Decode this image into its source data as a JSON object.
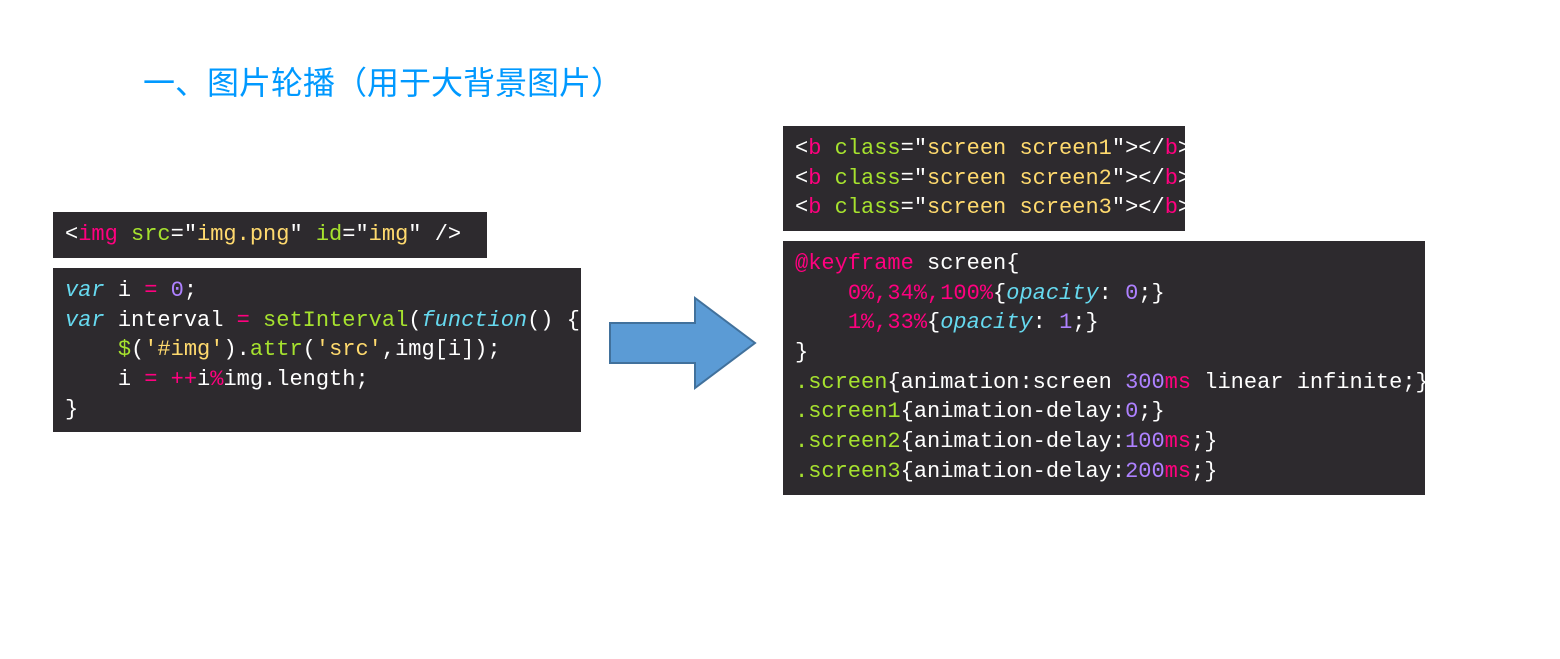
{
  "heading": "一、图片轮播（用于大背景图片）",
  "blk1": {
    "open_brkt": "<",
    "tag": "img",
    "sp1": " ",
    "a1": "src",
    "eq1": "=",
    "q1a": "\"",
    "v1": "img.png",
    "q1b": "\"",
    "sp2": " ",
    "a2": "id",
    "eq2": "=",
    "q2a": "\"",
    "v2": "img",
    "q2b": "\"",
    "sp3": " ",
    "selfclose": "/>"
  },
  "blk2": {
    "l1_var": "var",
    "l1_sp": " ",
    "l1_name": "i",
    "l1_sp2": " ",
    "l1_eq": "=",
    "l1_sp3": " ",
    "l1_zero": "0",
    "l1_semi": ";",
    "l2_var": "var",
    "l2_sp": " ",
    "l2_name": "interval",
    "l2_sp2": " ",
    "l2_eq": "=",
    "l2_sp3": " ",
    "l2_fn": "setInterval",
    "l2_paren": "(",
    "l2_func": "function",
    "l2_rest": "() {",
    "l3_ind": "    ",
    "l3_jq": "$",
    "l3_o": "(",
    "l3_q1": "'",
    "l3_sel": "#img",
    "l3_q2": "'",
    "l3_c": ").",
    "l3_attr": "attr",
    "l3_o2": "(",
    "l3_q3": "'",
    "l3_src": "src",
    "l3_q4": "'",
    "l3_comma": ",",
    "l3_imgi": "img[i]);",
    "l4_ind": "    ",
    "l4_i": "i ",
    "l4_eq": "=",
    "l4_expr": " ",
    "l4_pp": "++",
    "l4_rest": "i",
    "l4_mod": "%",
    "l4_rest2": "img.length;",
    "l5_close": "}"
  },
  "blk3": {
    "r1": {
      "lt": "<",
      "tag": "b",
      "sp": " ",
      "cls": "class",
      "eq": "=",
      "q": "\"",
      "val": "screen screen1",
      "q2": "\"",
      "gt": ">",
      "clt": "</",
      "ctag": "b",
      "cgt": ">"
    },
    "r2": {
      "lt": "<",
      "tag": "b",
      "sp": " ",
      "cls": "class",
      "eq": "=",
      "q": "\"",
      "val": "screen screen2",
      "q2": "\"",
      "gt": ">",
      "clt": "</",
      "ctag": "b",
      "cgt": ">"
    },
    "r3": {
      "lt": "<",
      "tag": "b",
      "sp": " ",
      "cls": "class",
      "eq": "=",
      "q": "\"",
      "val": "screen screen3",
      "q2": "\"",
      "gt": ">",
      "clt": "</",
      "ctag": "b",
      "cgt": ">"
    }
  },
  "blk4": {
    "l1a": "@keyframe",
    "l1b": " screen{",
    "l2_ind": "    ",
    "l2_pct": "0%,34%,100%",
    "l2_ob": "{",
    "l2_prop": "opacity",
    "l2_colon": ": ",
    "l2_val": "0",
    "l2_semi": ";",
    "l2_cb": "}",
    "l3_ind": "    ",
    "l3_pct": "1%,33%",
    "l3_ob": "{",
    "l3_prop": "opacity",
    "l3_colon": ": ",
    "l3_val": "1",
    "l3_semi": ";",
    "l3_cb": "}",
    "l4_close": "}",
    "l5_sel": ".screen",
    "l5_ob": "{",
    "l5_txt": "animation:screen ",
    "l5_num": "300",
    "l5_unit": "ms",
    "l5_rest": " linear infinite;",
    "l5_cb": "}",
    "l6_sel": ".screen1",
    "l6_ob": "{",
    "l6_txt": "animation-delay:",
    "l6_num": "0",
    "l6_semi": ";",
    "l6_cb": "}",
    "l7_sel": ".screen2",
    "l7_ob": "{",
    "l7_txt": "animation-delay:",
    "l7_num": "100",
    "l7_unit": "ms",
    "l7_semi": ";",
    "l7_cb": "}",
    "l8_sel": ".screen3",
    "l8_ob": "{",
    "l8_txt": "animation-delay:",
    "l8_num": "200",
    "l8_unit": "ms",
    "l8_semi": ";",
    "l8_cb": "}"
  }
}
